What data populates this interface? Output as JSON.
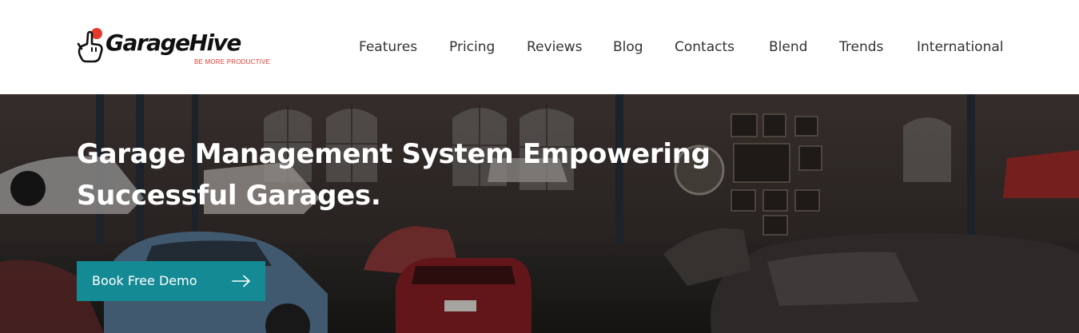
{
  "brand": {
    "name": "GarageHive",
    "tagline": "BE MORE PRODUCTIVE",
    "accent_color": "#e23a2b",
    "icon": "hand-pointer-logo-icon"
  },
  "nav": {
    "items": [
      {
        "label": "Features"
      },
      {
        "label": "Pricing"
      },
      {
        "label": "Reviews"
      },
      {
        "label": "Blog"
      },
      {
        "label": "Contacts"
      },
      {
        "label": "Blend"
      },
      {
        "label": "Trends"
      },
      {
        "label": "International"
      }
    ]
  },
  "hero": {
    "title": "Garage Management System Empowering Successful Garages.",
    "background": "garage-workshop-photo",
    "cta": {
      "label": "Book Free Demo",
      "icon": "arrow-right-icon",
      "color": "#148a94"
    }
  }
}
